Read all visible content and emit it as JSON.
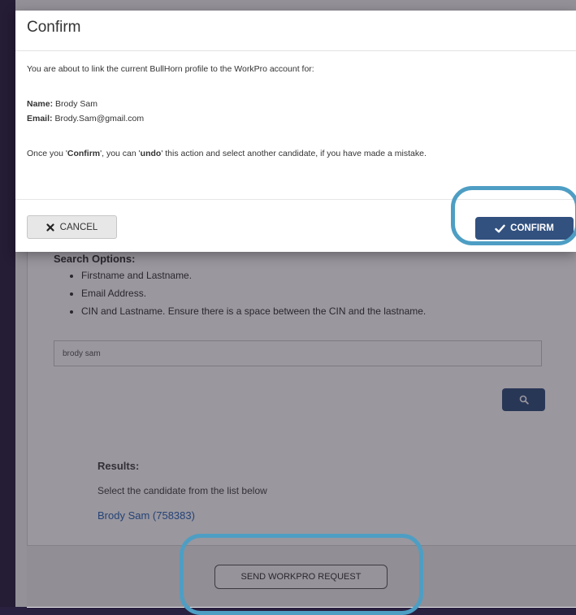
{
  "modal": {
    "title": "Confirm",
    "intro": "You are about to link the current BullHorn profile to the WorkPro account for:",
    "name_label": "Name:",
    "name_value": "Brody Sam",
    "email_label": "Email:",
    "email_value": "Brody.Sam@gmail.com",
    "note_part1": "Once you '",
    "note_confirm": "Confirm",
    "note_part2": "', you can '",
    "note_undo": "undo",
    "note_part3": "' this action and select another candidate, if you have made a mistake.",
    "cancel_label": "CANCEL",
    "confirm_label": "CONFIRM"
  },
  "search": {
    "options_title": "Search Options:",
    "options": [
      "Firstname and Lastname.",
      "Email Address.",
      "CIN and Lastname. Ensure there is a space between the CIN and the lastname."
    ],
    "input_value": "brody sam"
  },
  "results": {
    "label": "Results:",
    "hint": "Select the candidate from the list below",
    "candidate": "Brody Sam (758383)"
  },
  "footer": {
    "send_request_label": "SEND WORKPRO REQUEST"
  },
  "colors": {
    "primary_button": "#32517f",
    "highlight_ring": "#4e9ec4",
    "link": "#2a66b8"
  }
}
